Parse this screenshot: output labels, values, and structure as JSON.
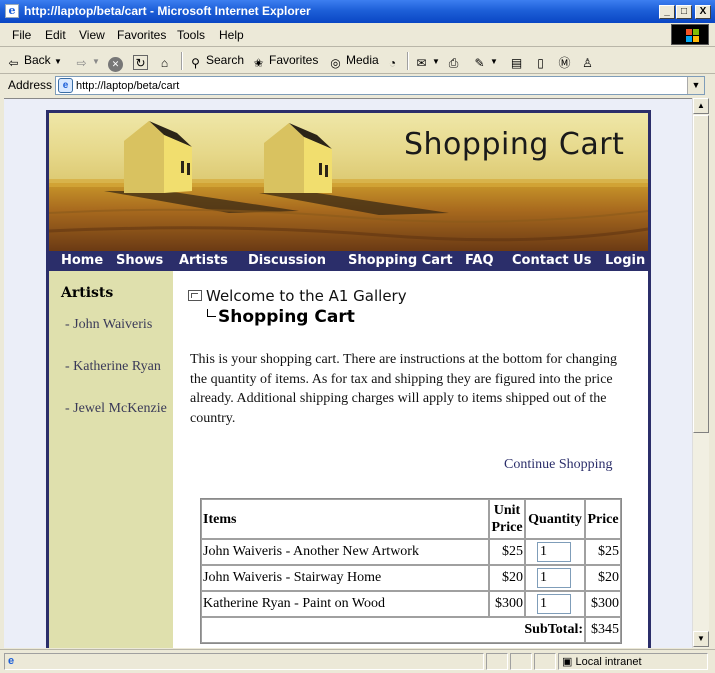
{
  "window": {
    "title": "http://laptop/beta/cart - Microsoft Internet Explorer",
    "min_glyph": "_",
    "max_glyph": "□",
    "close_glyph": "X"
  },
  "menu": [
    "File",
    "Edit",
    "View",
    "Favorites",
    "Tools",
    "Help"
  ],
  "toolbar": {
    "back": "Back",
    "search": "Search",
    "favorites": "Favorites",
    "media": "Media"
  },
  "address": {
    "label": "Address",
    "url": "http://laptop/beta/cart"
  },
  "status": {
    "zone": "Local intranet"
  },
  "banner": {
    "title": "Shopping Cart"
  },
  "nav": [
    "Home",
    "Shows",
    "Artists",
    "Discussion",
    "Shopping Cart",
    "FAQ",
    "Contact Us",
    "Login"
  ],
  "sidebar": {
    "heading": "Artists",
    "links": [
      "- John Waiveris",
      "- Katherine Ryan",
      "- Jewel McKenzie"
    ]
  },
  "breadcrumb": {
    "parent": "Welcome to the A1 Gallery",
    "current": "Shopping Cart"
  },
  "intro": "This is your shopping cart. There are instructions at the bottom for changing the quantity of items. As for tax and shipping they are figured into the price already. Additional shipping charges will apply to items shipped out of the country.",
  "continue_link": "Continue Shopping",
  "cart": {
    "headers": {
      "items": "Items",
      "unit_price": "Unit Price",
      "quantity": "Quantity",
      "price": "Price"
    },
    "rows": [
      {
        "item": "John Waiveris - Another New Artwork",
        "unit_price": "$25",
        "quantity": "1",
        "price": "$25"
      },
      {
        "item": "John Waiveris - Stairway Home",
        "unit_price": "$20",
        "quantity": "1",
        "price": "$20"
      },
      {
        "item": "Katherine Ryan - Paint on Wood",
        "unit_price": "$300",
        "quantity": "1",
        "price": "$300"
      }
    ],
    "subtotal_label": "SubTotal:",
    "subtotal": "$345"
  }
}
